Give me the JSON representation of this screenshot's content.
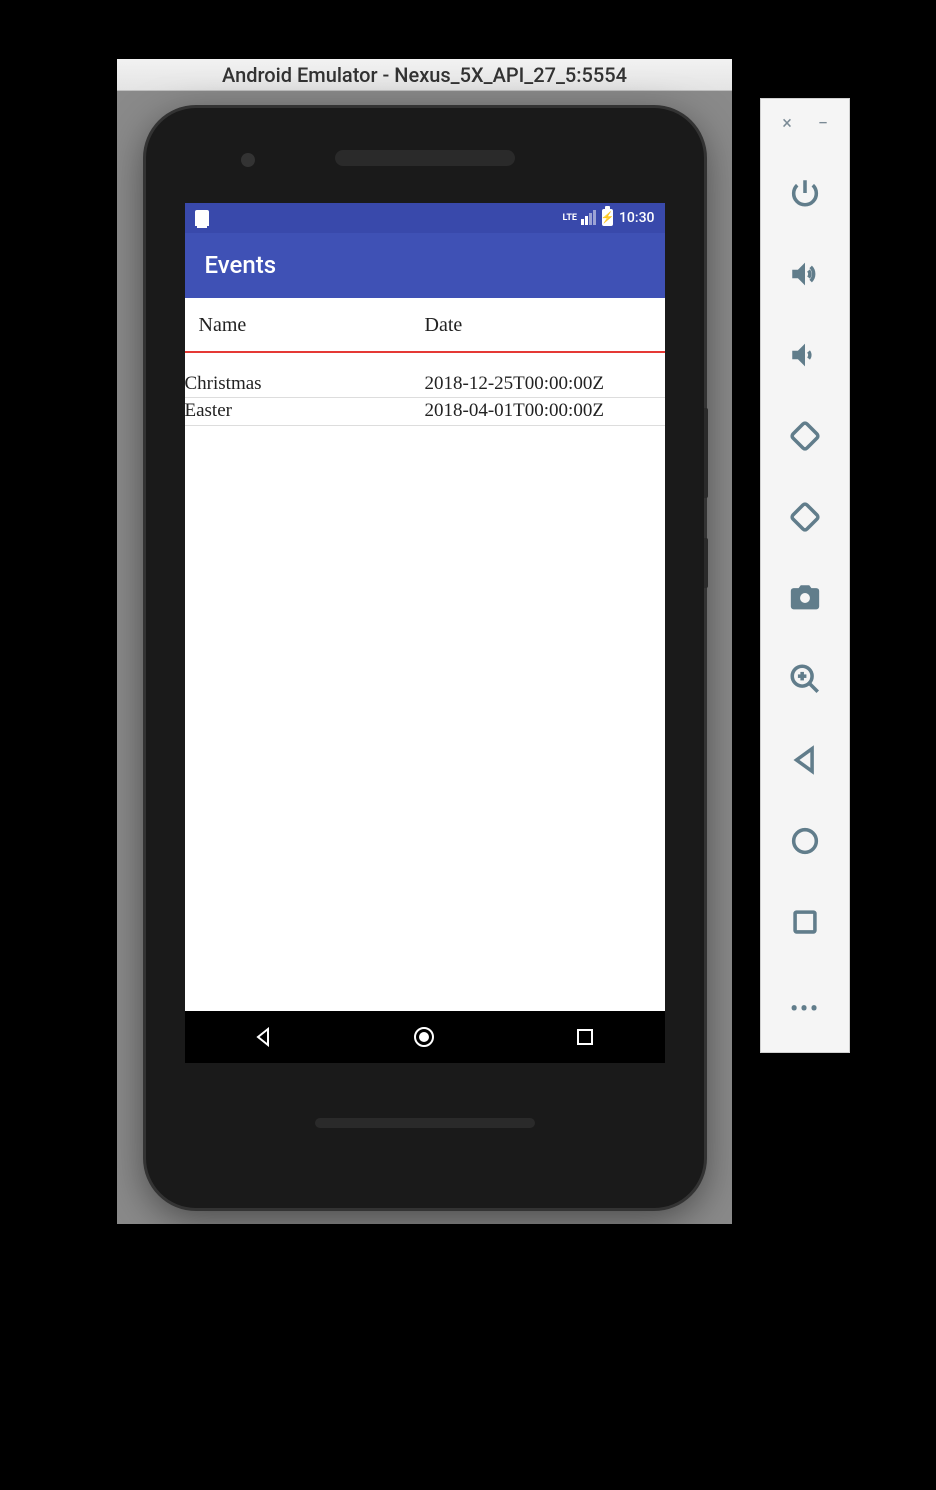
{
  "window": {
    "title": "Android Emulator - Nexus_5X_API_27_5:5554"
  },
  "statusBar": {
    "lte": "LTE",
    "time": "10:30"
  },
  "appBar": {
    "title": "Events"
  },
  "table": {
    "headers": {
      "name": "Name",
      "date": "Date"
    },
    "rows": [
      {
        "name": "Christmas",
        "date": "2018-12-25T00:00:00Z"
      },
      {
        "name": "Easter",
        "date": "2018-04-01T00:00:00Z"
      }
    ]
  },
  "toolbar": {
    "close": "×",
    "minimize": "−",
    "more": "•••"
  }
}
